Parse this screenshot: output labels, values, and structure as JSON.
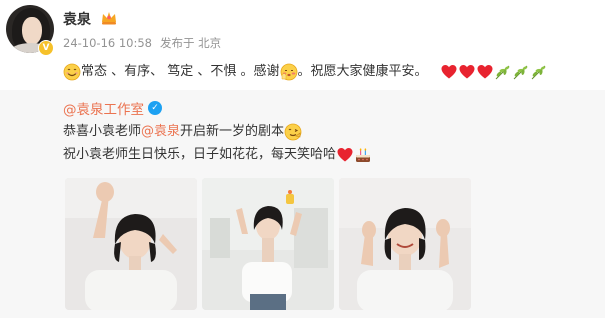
{
  "post": {
    "username": "袁泉",
    "meta": {
      "timestamp": "24-10-16 10:58",
      "location": "发布于 北京"
    },
    "text": {
      "part1": "常态 、有序、 笃定 、不惧 。感谢",
      "part2": "。祝愿大家健康平安。"
    }
  },
  "retweet": {
    "author": "@袁泉工作室",
    "line1": {
      "prefix": "恭喜小袁老师",
      "mention": "@袁泉",
      "suffix": " 开启新一岁的剧本"
    },
    "line2": {
      "text": "祝小袁老师生日快乐，日子如花花，每天笑哈哈"
    }
  },
  "icons": {
    "avatar_badge": "vip-badge-icon",
    "crown": "crown-icon",
    "verified": "verified-blue-icon",
    "smile": "smile-emoji",
    "shy": "shy-emoji",
    "heart": "heart-emoji",
    "leaf": "leaf-emoji",
    "wink": "wink-emoji",
    "cake": "cake-emoji"
  },
  "colors": {
    "mention": "#eb7350",
    "meta": "#939393",
    "retweet_bg": "#f7f7f7",
    "verified": "#1da1f2",
    "heart": "#e8232f"
  }
}
